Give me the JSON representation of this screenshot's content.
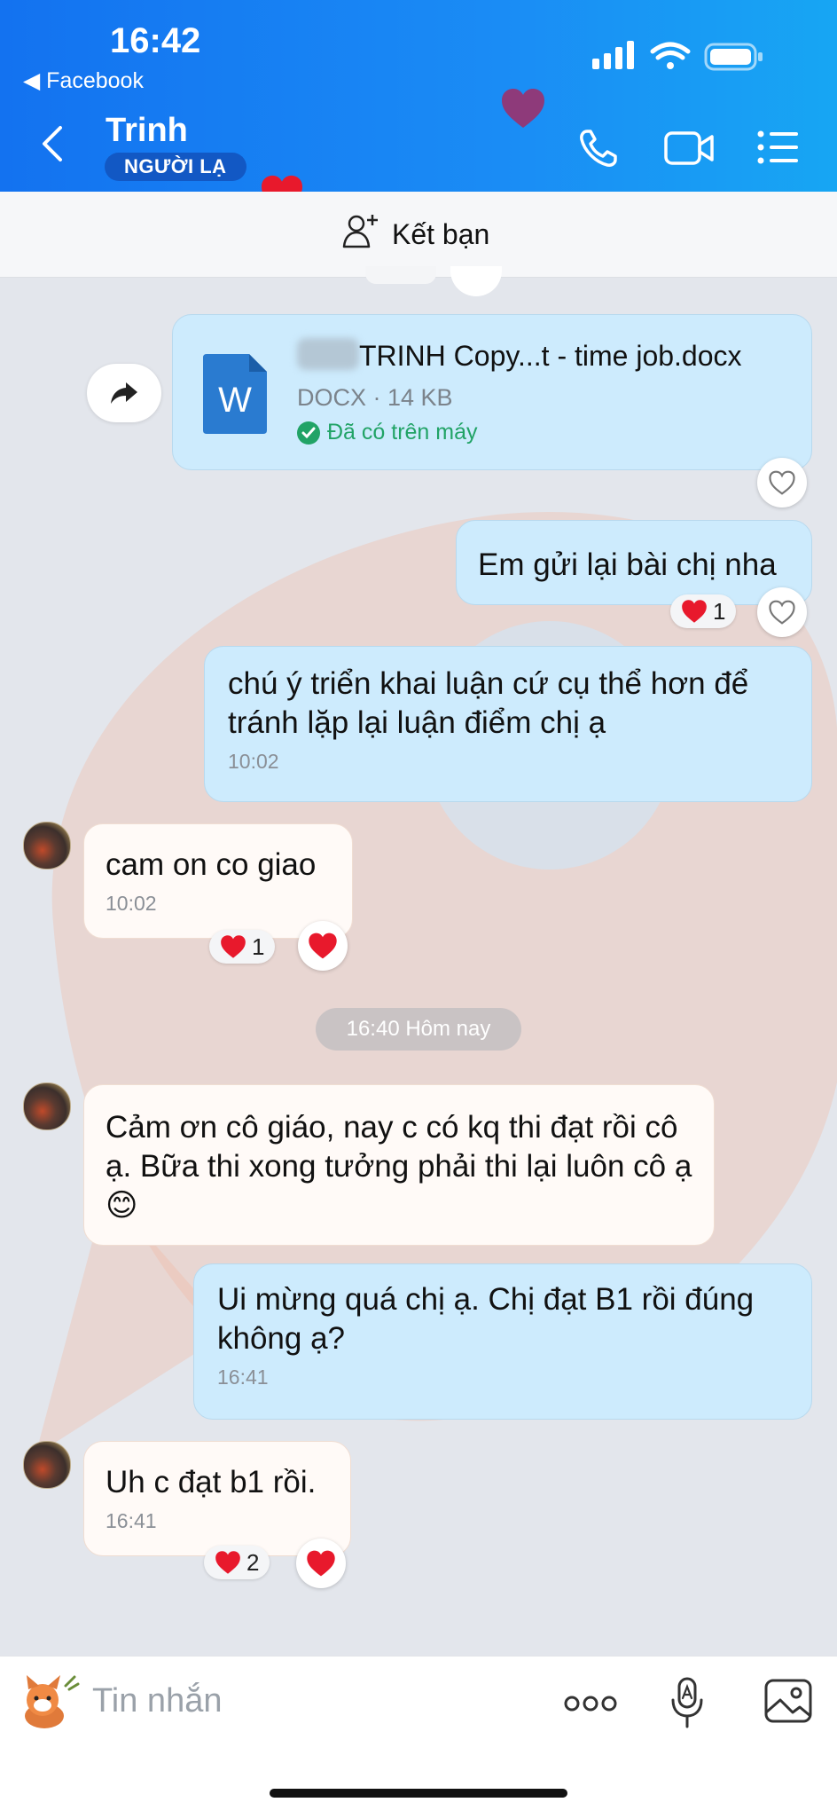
{
  "status_bar": {
    "time": "16:42",
    "back_app": "◀ Facebook"
  },
  "header": {
    "contact_name": "Trinh",
    "stranger_badge": "NGƯỜI LẠ"
  },
  "friend_bar": {
    "add_friend_label": "Kết bạn"
  },
  "messages": [
    {
      "type": "file",
      "from": "me",
      "file_name": "TRINH Copy...t - time job.docx",
      "file_meta": "DOCX · 14 KB",
      "file_status": "Đã có trên máy",
      "file_icon_letter": "W"
    },
    {
      "from": "me",
      "text": "Em gửi lại bài chị nha",
      "reaction_count": "1"
    },
    {
      "from": "me",
      "text": "chú ý triển khai luận cứ cụ thể hơn để tránh lặp lại luận điểm chị ạ",
      "time": "10:02"
    },
    {
      "from": "them",
      "text": "cam on co giao",
      "time": "10:02",
      "reaction_count": "1"
    },
    {
      "from": "them",
      "text": "Cảm ơn cô giáo, nay c có kq thi đạt rồi cô ạ. Bữa thi xong tưởng phải thi lại luôn cô ạ 😊"
    },
    {
      "from": "me",
      "text": "Ui mừng quá chị ạ. Chị đạt B1 rồi đúng không ạ?",
      "time": "16:41"
    },
    {
      "from": "them",
      "text": "Uh c đạt b1 rồi.",
      "time": "16:41",
      "reaction_count": "2"
    }
  ],
  "date_divider": "16:40 Hôm nay",
  "footer": {
    "input_placeholder": "Tin nhắn"
  },
  "colors": {
    "header_blue": "#1372f0",
    "my_bubble": "#cdebfd",
    "their_bubble": "#fffaf7",
    "heart_red": "#e8192c"
  }
}
